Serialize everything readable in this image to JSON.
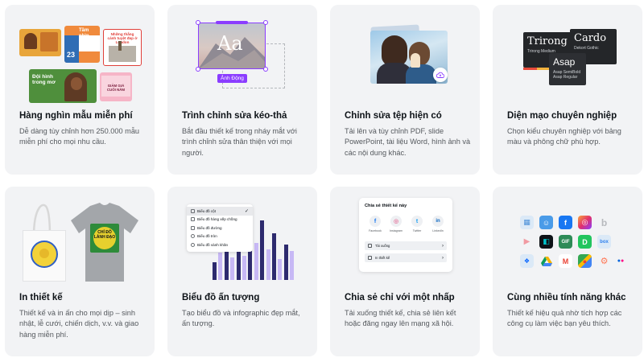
{
  "cards": [
    {
      "title": "Hàng nghìn mẫu miễn phí",
      "desc": "Dễ dàng tùy chỉnh hơn 250.000 mẫu miễn phí cho mọi nhu cầu.",
      "art": {
        "tpl_tam_nhin": "Tầm nhìn",
        "tpl_tam_nhin_num": "23",
        "tpl_london": "Những thắng cảnh tuyệt đẹp ở London",
        "tpl_doi_hinh": "Đội hình trong mơ",
        "tpl_giam_gia": "GIẢM GIÁ CUỐI NĂM"
      }
    },
    {
      "title": "Trình chỉnh sửa kéo-thả",
      "desc": "Bắt đầu thiết kế trong nháy mắt với trình chỉnh sửa thân thiện với mọi người.",
      "art": {
        "aa_text": "Aa",
        "tag_label": "Ảnh Động"
      }
    },
    {
      "title": "Chỉnh sửa tệp hiện có",
      "desc": "Tải lên và tùy chỉnh PDF, slide PowerPoint, tài liệu Word, hình ảnh và các nội dung khác."
    },
    {
      "title": "Diện mạo chuyên nghiệp",
      "desc": "Chọn kiểu chuyên nghiệp với bảng màu và phông chữ phù hợp.",
      "art": {
        "font1_big": "Trirong",
        "font1_small": "Trirong Medium",
        "font2_big": "Cardo",
        "font2_small": "Dekort Gothic",
        "font3_big": "Asap",
        "font3_small": "Asap SemiBold",
        "font3_small2": "Asap Regular"
      }
    },
    {
      "title": "In thiết kế",
      "desc": "Thiết kế và in ấn cho mọi dịp – sinh nhật, lễ cưới, chiến dịch, v.v. và giao hàng miễn phí.",
      "art": {
        "shirt_text": "CHỈ ĐỖ LÀNH ĐẠO"
      }
    },
    {
      "title": "Biểu đồ ấn tượng",
      "desc": "Tạo biểu đồ và infographic đẹp mắt, ấn tượng.",
      "art": {
        "menu": [
          "Biểu đồ cột",
          "Biểu đồ hàng xếp chồng",
          "Biểu đồ đường",
          "Biểu đồ tròn",
          "Biểu đồ vành khăn"
        ],
        "selected": "Biểu đồ cột"
      }
    },
    {
      "title": "Chia sẻ chỉ với một nhấp",
      "desc": "Tải xuống thiết kế, chia sẻ liên kết hoặc đăng ngay lên mạng xã hội.",
      "art": {
        "panel_title": "Chia sẻ thiết kế này",
        "socials": [
          "Facebook",
          "Instagram",
          "Twitter",
          "LinkedIn"
        ],
        "row1": "Tải xuống",
        "row2": "In thiết kế"
      }
    },
    {
      "title": "Cùng nhiều tính năng khác",
      "desc": "Thiết kế hiệu quả nhờ tích hợp các công cụ làm việc bạn yêu thích."
    }
  ],
  "colors": {
    "card_bg": "#f2f3f5",
    "accent_purple": "#8b3dff",
    "title_text": "#0e1318",
    "desc_text": "#55595e"
  }
}
